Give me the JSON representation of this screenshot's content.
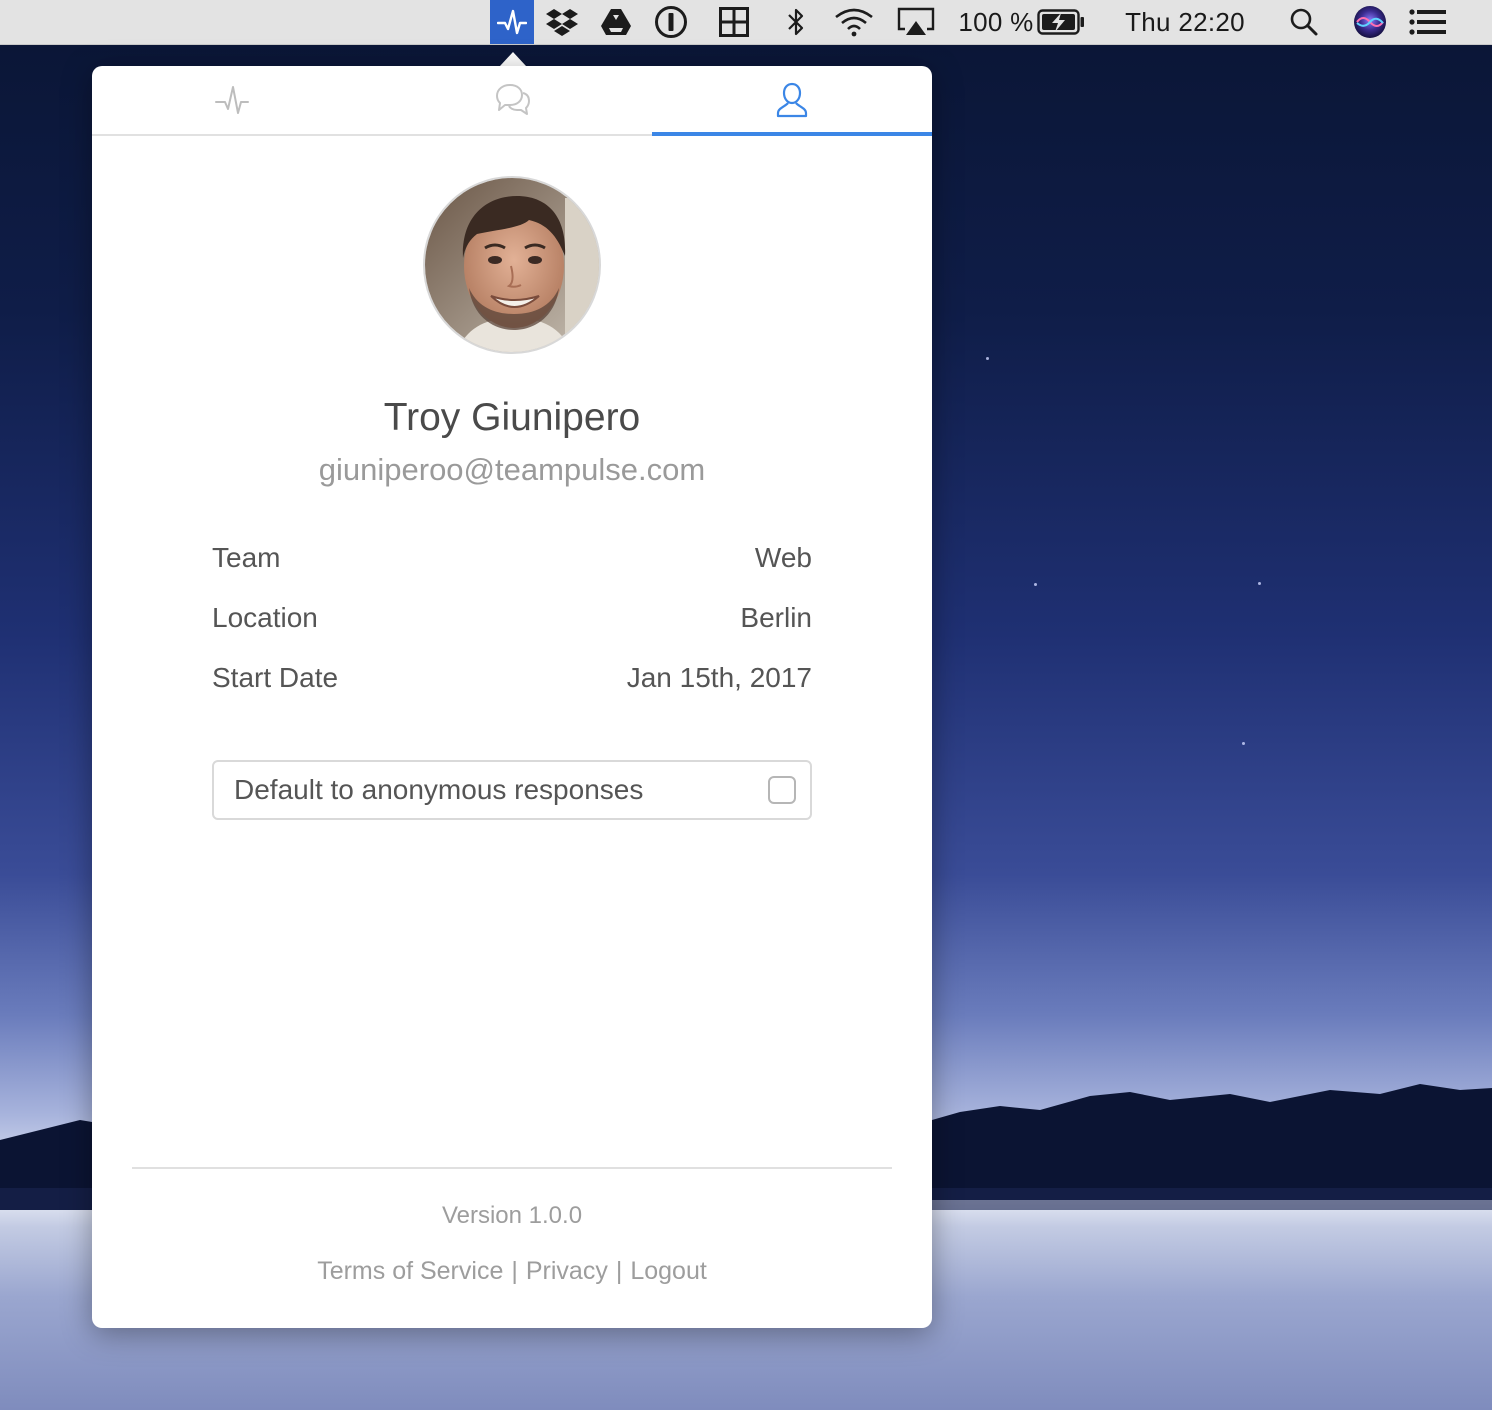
{
  "menubar": {
    "battery_percent": "100 %",
    "clock": "Thu 22:20",
    "icons": [
      "pulse-icon",
      "dropbox-icon",
      "google-drive-icon",
      "1password-icon",
      "grid-app-icon",
      "bluetooth-icon",
      "wifi-icon",
      "airplay-icon",
      "battery-icon",
      "spotlight-search-icon",
      "siri-icon",
      "notification-center-icon"
    ]
  },
  "popover": {
    "tabs": [
      {
        "icon": "pulse-icon",
        "active": false
      },
      {
        "icon": "chat-bubbles-icon",
        "active": false
      },
      {
        "icon": "user-icon",
        "active": true
      }
    ],
    "profile": {
      "name": "Troy Giunipero",
      "email": "giuniperoo@teampulse.com"
    },
    "details": [
      {
        "label": "Team",
        "value": "Web"
      },
      {
        "label": "Location",
        "value": "Berlin"
      },
      {
        "label": "Start Date",
        "value": "Jan 15th, 2017"
      }
    ],
    "anonymous_option": {
      "label": "Default to anonymous responses",
      "checked": false
    },
    "footer": {
      "version": "Version 1.0.0",
      "links": {
        "terms": "Terms of Service",
        "privacy": "Privacy",
        "logout": "Logout",
        "separator": "|"
      }
    }
  },
  "colors": {
    "accent": "#3b86e6",
    "menubar_active": "#2e63c9",
    "text_primary": "#4a4a4a",
    "text_muted": "#9d9d9d"
  }
}
